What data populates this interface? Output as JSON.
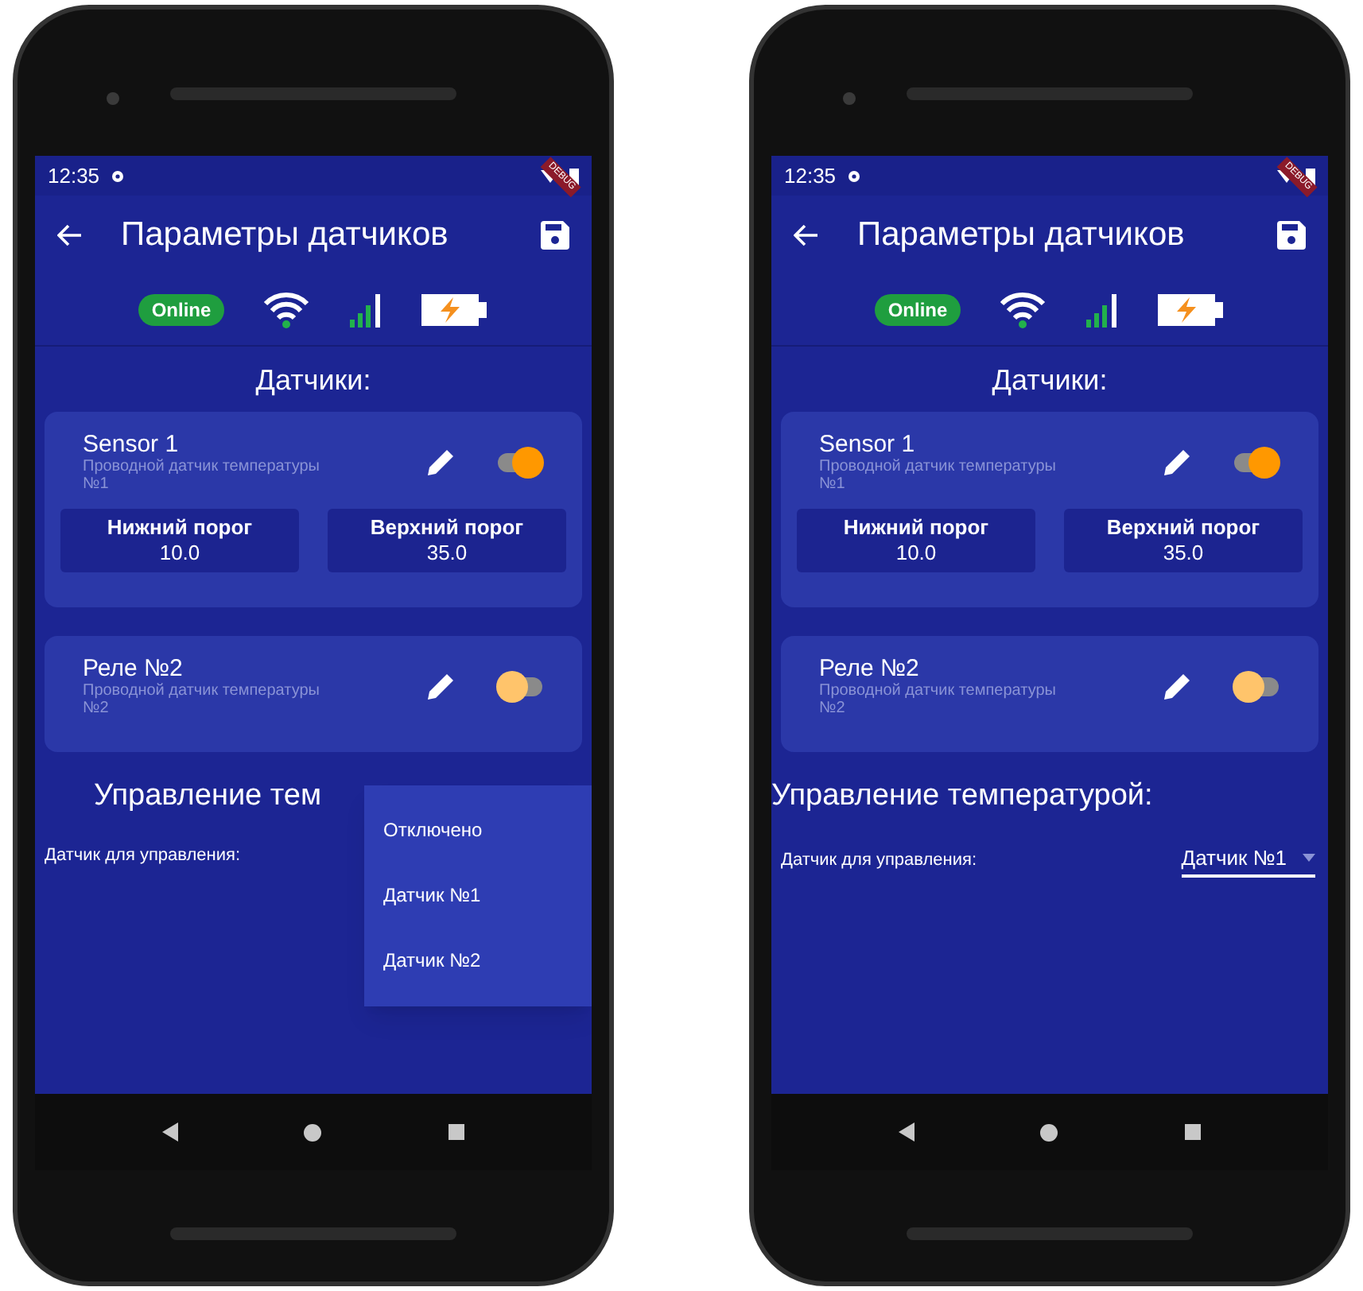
{
  "phones": [
    {
      "status_bar": {
        "time": "12:35",
        "debug_banner": "DEBUG"
      },
      "app_bar": {
        "title": "Параметры датчиков"
      },
      "status_row": {
        "badge": "Online"
      },
      "section_title": "Датчики:",
      "sensors": [
        {
          "name": "Sensor 1",
          "description": "Проводной датчик температуры №1",
          "on": true,
          "thresholds": [
            {
              "label": "Нижний порог",
              "value": "10.0"
            },
            {
              "label": "Верхний порог",
              "value": "35.0"
            }
          ]
        },
        {
          "name": "Реле №2",
          "description": "Проводной датчик температуры №2",
          "on": false
        }
      ],
      "control": {
        "title": "Управление тем",
        "label": "Датчик для управления:",
        "menu": [
          "Отключено",
          "Датчик №1",
          "Датчик №2"
        ]
      }
    },
    {
      "status_bar": {
        "time": "12:35",
        "debug_banner": "DEBUG"
      },
      "app_bar": {
        "title": "Параметры датчиков"
      },
      "status_row": {
        "badge": "Online"
      },
      "section_title": "Датчики:",
      "sensors": [
        {
          "name": "Sensor 1",
          "description": "Проводной датчик температуры №1",
          "on": true,
          "thresholds": [
            {
              "label": "Нижний порог",
              "value": "10.0"
            },
            {
              "label": "Верхний порог",
              "value": "35.0"
            }
          ]
        },
        {
          "name": "Реле №2",
          "description": "Проводной датчик температуры №2",
          "on": false
        }
      ],
      "control": {
        "title": "Управление температурой:",
        "label": "Датчик для управления:",
        "dropdown": {
          "value": "Датчик №1"
        }
      }
    }
  ]
}
